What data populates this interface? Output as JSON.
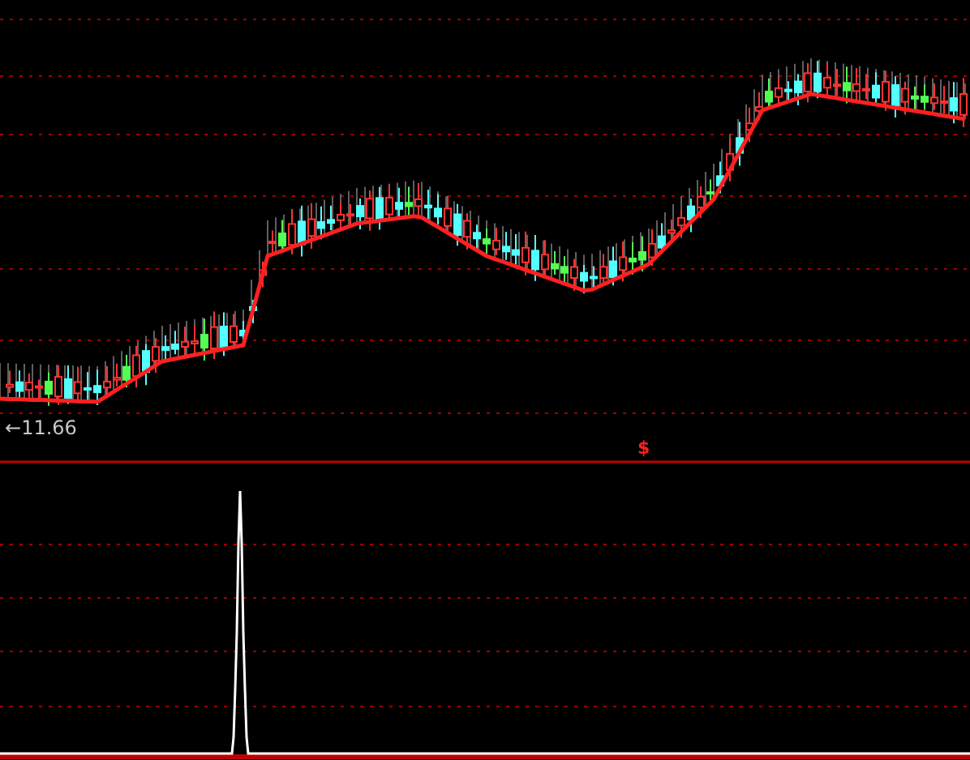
{
  "price_label": {
    "arrow": "←",
    "value": "11.66"
  },
  "signal_mark": "$"
}
